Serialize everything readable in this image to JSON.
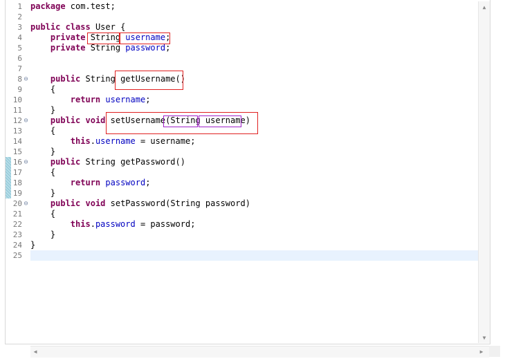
{
  "editor": {
    "line_numbers": [
      "1",
      "2",
      "3",
      "4",
      "5",
      "6",
      "7",
      "8",
      "9",
      "10",
      "11",
      "12",
      "13",
      "14",
      "15",
      "16",
      "17",
      "18",
      "19",
      "20",
      "21",
      "22",
      "23",
      "24",
      "25"
    ],
    "fold_icon": "minus-circle-icon",
    "code": [
      [
        {
          "t": "package",
          "k": "kw"
        },
        {
          "t": " com.test;",
          "k": ""
        }
      ],
      [],
      [
        {
          "t": "public",
          "k": "kw"
        },
        {
          "t": " ",
          "k": ""
        },
        {
          "t": "class",
          "k": "kw"
        },
        {
          "t": " User {",
          "k": ""
        }
      ],
      [
        {
          "t": "    ",
          "k": ""
        },
        {
          "t": "private",
          "k": "kw"
        },
        {
          "t": " String ",
          "k": ""
        },
        {
          "t": "username",
          "k": "fld"
        },
        {
          "t": ";",
          "k": ""
        }
      ],
      [
        {
          "t": "    ",
          "k": ""
        },
        {
          "t": "private",
          "k": "kw"
        },
        {
          "t": " String ",
          "k": ""
        },
        {
          "t": "password",
          "k": "fld"
        },
        {
          "t": ";",
          "k": ""
        }
      ],
      [],
      [],
      [
        {
          "t": "    ",
          "k": ""
        },
        {
          "t": "public",
          "k": "kw"
        },
        {
          "t": " String getUsername()",
          "k": ""
        }
      ],
      [
        {
          "t": "    {",
          "k": ""
        }
      ],
      [
        {
          "t": "        ",
          "k": ""
        },
        {
          "t": "return",
          "k": "kw"
        },
        {
          "t": " ",
          "k": ""
        },
        {
          "t": "username",
          "k": "fld"
        },
        {
          "t": ";",
          "k": ""
        }
      ],
      [
        {
          "t": "    }",
          "k": ""
        }
      ],
      [
        {
          "t": "    ",
          "k": ""
        },
        {
          "t": "public",
          "k": "kw"
        },
        {
          "t": " ",
          "k": ""
        },
        {
          "t": "void",
          "k": "kw"
        },
        {
          "t": " setUsername(String username)",
          "k": ""
        }
      ],
      [
        {
          "t": "    {",
          "k": ""
        }
      ],
      [
        {
          "t": "        ",
          "k": ""
        },
        {
          "t": "this",
          "k": "kw"
        },
        {
          "t": ".",
          "k": ""
        },
        {
          "t": "username",
          "k": "fld"
        },
        {
          "t": " = username;",
          "k": ""
        }
      ],
      [
        {
          "t": "    }",
          "k": ""
        }
      ],
      [
        {
          "t": "    ",
          "k": ""
        },
        {
          "t": "public",
          "k": "kw"
        },
        {
          "t": " String getPassword()",
          "k": ""
        }
      ],
      [
        {
          "t": "    {",
          "k": ""
        }
      ],
      [
        {
          "t": "        ",
          "k": ""
        },
        {
          "t": "return",
          "k": "kw"
        },
        {
          "t": " ",
          "k": ""
        },
        {
          "t": "password",
          "k": "fld"
        },
        {
          "t": ";",
          "k": ""
        }
      ],
      [
        {
          "t": "    }",
          "k": ""
        }
      ],
      [
        {
          "t": "    ",
          "k": ""
        },
        {
          "t": "public",
          "k": "kw"
        },
        {
          "t": " ",
          "k": ""
        },
        {
          "t": "void",
          "k": "kw"
        },
        {
          "t": " setPassword(String password)",
          "k": ""
        }
      ],
      [
        {
          "t": "    {",
          "k": ""
        }
      ],
      [
        {
          "t": "        ",
          "k": ""
        },
        {
          "t": "this",
          "k": "kw"
        },
        {
          "t": ".",
          "k": ""
        },
        {
          "t": "password",
          "k": "fld"
        },
        {
          "t": " = password;",
          "k": ""
        }
      ],
      [
        {
          "t": "    }",
          "k": ""
        }
      ],
      [
        {
          "t": "}",
          "k": ""
        }
      ],
      []
    ],
    "folded_lines": [
      8,
      12,
      16,
      20
    ],
    "current_line": 25,
    "colors": {
      "keyword": "#7f0055",
      "field": "#0000c0",
      "current_line": "#e8f2fe",
      "highlight_red": "#e02020",
      "highlight_purple": "#a020c8"
    }
  },
  "scrollbars": {
    "up_arrow": "▲",
    "down_arrow": "▼",
    "left_arrow": "◀",
    "right_arrow": "▶"
  }
}
